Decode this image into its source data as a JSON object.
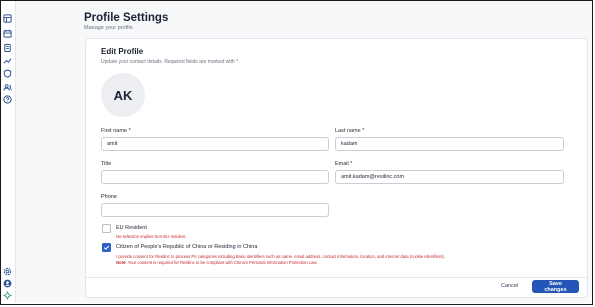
{
  "page": {
    "title": "Profile Settings",
    "subtitle": "Manage your profile."
  },
  "sidebar": {
    "top_icons": [
      "grid-icon",
      "calendar-icon",
      "clipboard-icon",
      "trend-icon",
      "shield-icon",
      "users-icon",
      "help-icon"
    ],
    "bottom_icons": [
      "settings-icon",
      "user-circle-icon",
      "logo-icon"
    ]
  },
  "card": {
    "title": "Edit Profile",
    "subtitle": "Update your contact details. Required fields are marked with *.",
    "avatar_initials": "AK"
  },
  "form": {
    "first_name": {
      "label": "First name *",
      "value": "amit"
    },
    "last_name": {
      "label": "Last name *",
      "value": "kadam"
    },
    "title": {
      "label": "Title",
      "value": ""
    },
    "email": {
      "label": "Email *",
      "value": "amit.kadam@resilinc.com"
    },
    "phone": {
      "label": "Phone",
      "value": ""
    }
  },
  "eu_resident": {
    "label": "EU Resident",
    "checked": false,
    "note": "No selection implies Non-EU resident."
  },
  "china_resident": {
    "label": "Citizen of People's Republic of China or Residing in China",
    "checked": true,
    "consent": "I provide consent for Resilinc to process PII categories including basic identifiers such as name, email address, contact information, location, and internet data (cookie identifiers).",
    "note_bold": "Note:",
    "note": " Your consent is required for Resilinc to be compliant with China's Personal Information Protection Law."
  },
  "actions": {
    "cancel_label": "Cancel",
    "save_label": "Save changes"
  },
  "colors": {
    "accent": "#2456b7",
    "error": "#c62828",
    "sidebar_icon": "#2c4f8f"
  }
}
